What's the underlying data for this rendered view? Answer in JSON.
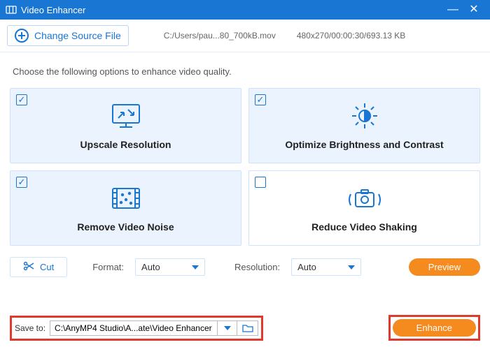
{
  "titlebar": {
    "title": "Video Enhancer"
  },
  "source": {
    "changeLabel": "Change Source File",
    "path": "C:/Users/pau...80_700kB.mov",
    "meta": "480x270/00:00:30/693.13 KB"
  },
  "prompt": "Choose the following options to enhance video quality.",
  "options": {
    "upscale": {
      "label": "Upscale Resolution",
      "checked": "✓"
    },
    "brightness": {
      "label": "Optimize Brightness and Contrast",
      "checked": "✓"
    },
    "noise": {
      "label": "Remove Video Noise",
      "checked": "✓"
    },
    "shaking": {
      "label": "Reduce Video Shaking",
      "checked": ""
    }
  },
  "tools": {
    "cutLabel": "Cut",
    "formatLabel": "Format:",
    "formatValue": "Auto",
    "resolutionLabel": "Resolution:",
    "resolutionValue": "Auto",
    "previewLabel": "Preview"
  },
  "save": {
    "label": "Save to:",
    "path": "C:\\AnyMP4 Studio\\A...ate\\Video Enhancer"
  },
  "enhance": {
    "label": "Enhance"
  }
}
